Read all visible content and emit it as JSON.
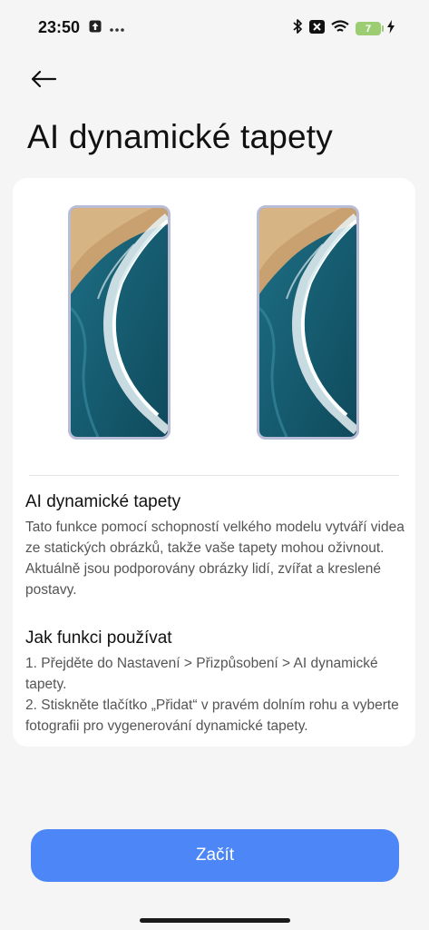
{
  "status_bar": {
    "time": "23:50",
    "battery_level": "7",
    "icons": [
      "upload-icon",
      "more-dots-icon",
      "bluetooth-icon",
      "close-box-icon",
      "wifi-icon",
      "battery-icon",
      "charging-icon"
    ]
  },
  "header": {
    "back_icon": "back-arrow-icon",
    "title": "AI dynamické tapety"
  },
  "card": {
    "previews": [
      "wave-wallpaper-preview",
      "wave-wallpaper-preview"
    ],
    "section1": {
      "title": "AI dynamické tapety",
      "text": "Tato funkce pomocí schopností velkého modelu vytváří videa ze statických obrázků, takže vaše tapety mohou oživnout. Aktuálně jsou podporovány obrázky lidí, zvířat a kreslené postavy."
    },
    "section2": {
      "title": "Jak funkci používat",
      "step1": "1. Přejděte do Nastavení > Přizpůsobení > AI dynamické tapety.",
      "step2": "2. Stiskněte tlačítko „Přidat“ v pravém dolním rohu a vyberte fotografii pro vygenerování dynamické tapety."
    }
  },
  "actions": {
    "start_label": "Začít"
  },
  "colors": {
    "accent": "#4d87f7",
    "background": "#f5f5f5",
    "card": "#ffffff",
    "battery": "#9ccd73",
    "preview_border": "#b8bcd6"
  }
}
